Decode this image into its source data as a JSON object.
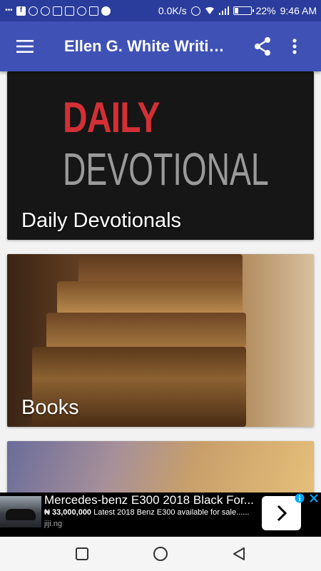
{
  "status_bar": {
    "network_speed": "0.0K/s",
    "battery": "22%",
    "battery_level": 0.22,
    "time": "9:46 AM",
    "left_icons": [
      "more-dots-icon",
      "facebook-icon",
      "messenger-icon",
      "messenger-icon",
      "gallery-icon",
      "chat-icon",
      "whatsapp-icon",
      "instagram-icon",
      "soccer-icon"
    ],
    "right_icons": [
      "alarm-icon",
      "wifi-icon",
      "signal-icon",
      "battery-icon"
    ]
  },
  "app_bar": {
    "title": "Ellen G. White Writings",
    "menu_icon": "hamburger-menu-icon",
    "share_icon": "share-icon",
    "more_icon": "more-vertical-icon",
    "color": "#3f51b5"
  },
  "cards": [
    {
      "label": "Daily Devotionals",
      "image_text": [
        "DAILY",
        "DEVOTIONAL"
      ]
    },
    {
      "label": "Books"
    },
    {
      "label": ""
    }
  ],
  "ad": {
    "title": "Mercedes-benz E300 2018 Black For...",
    "price": "₦ 33,000,000",
    "description": "Latest 2018 Benz E300 available for sale......",
    "domain": "jiji.ng",
    "arrow_icon": "chevron-right-icon",
    "info_icon": "info-icon",
    "close_icon": "close-icon",
    "accent": "#00aaff"
  },
  "nav_bar": {
    "buttons": [
      "recents-icon",
      "home-icon",
      "back-icon"
    ]
  }
}
